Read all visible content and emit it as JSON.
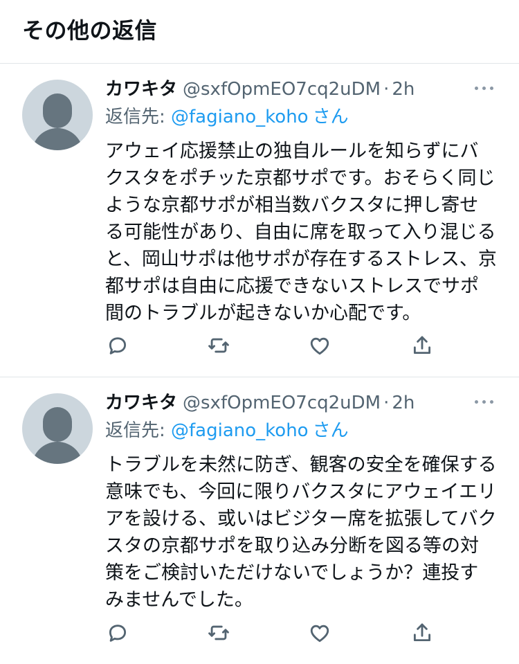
{
  "section": {
    "title": "その他の返信"
  },
  "tweets": [
    {
      "name": "カワキタ",
      "handle": "@sxfOpmEO7cq2uDM",
      "separator": "·",
      "time": "2h",
      "reply_label": "返信先:",
      "reply_user": "@fagiano_koho",
      "reply_suffix": "さん",
      "text": "アウェイ応援禁止の独自ルールを知らずにバクスタをポチッた京都サポです。おそらく同じような京都サポが相当数バクスタに押し寄せる可能性があり、自由に席を取って入り混じると、岡山サポは他サポが存在するストレス、京都サポは自由に応援できないストレスでサポ間のトラブルが起きないか心配です。"
    },
    {
      "name": "カワキタ",
      "handle": "@sxfOpmEO7cq2uDM",
      "separator": "·",
      "time": "2h",
      "reply_label": "返信先:",
      "reply_user": "@fagiano_koho",
      "reply_suffix": "さん",
      "text": "トラブルを未然に防ぎ、観客の安全を確保する意味でも、今回に限りバクスタにアウェイエリアを設ける、或いはビジター席を拡張してバクスタの京都サポを取り込み分断を図る等の対策をご検討いただけないでしょうか？連投すみませんでした。"
    }
  ],
  "icons": {
    "avatar": "default-avatar",
    "more": "more-horizontal-icon",
    "reply": "reply-icon",
    "retweet": "retweet-icon",
    "like": "heart-icon",
    "share": "share-icon"
  },
  "colors": {
    "link": "#1d9bf0",
    "secondary_text": "#536471",
    "primary_text": "#0f1419",
    "divider": "#e1e5e8",
    "avatar_bg": "#ccd6dd",
    "avatar_fg": "#66757f"
  }
}
